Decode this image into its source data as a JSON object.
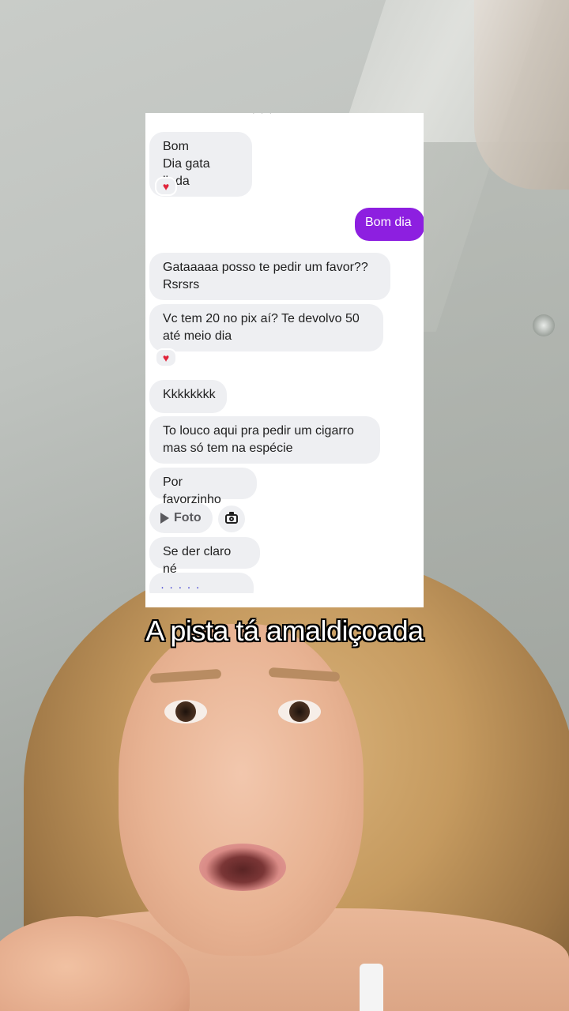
{
  "caption": "A pista tá amaldiçoada",
  "chat": {
    "messages": [
      {
        "from": "them",
        "text": "Bom\nDia gata linda",
        "reaction": "♥"
      },
      {
        "from": "me",
        "text": "Bom dia"
      },
      {
        "from": "them",
        "text": "Gataaaaa posso te pedir um favor??\nRsrsrs"
      },
      {
        "from": "them",
        "text": "Vc tem 20 no pix aí? Te devolvo 50\naté meio dia",
        "reaction": "♥"
      },
      {
        "from": "them",
        "text": "Kkkkkkkk"
      },
      {
        "from": "them",
        "text": "To louco aqui pra pedir um cigarro\nmas só tem na espécie"
      },
      {
        "from": "them",
        "text": "Por favorzinho"
      },
      {
        "from": "them",
        "text": "Se der claro né"
      }
    ],
    "photo_label": "Foto",
    "accent_color": "#8d1fe0",
    "reaction_color": "#e0243a"
  }
}
